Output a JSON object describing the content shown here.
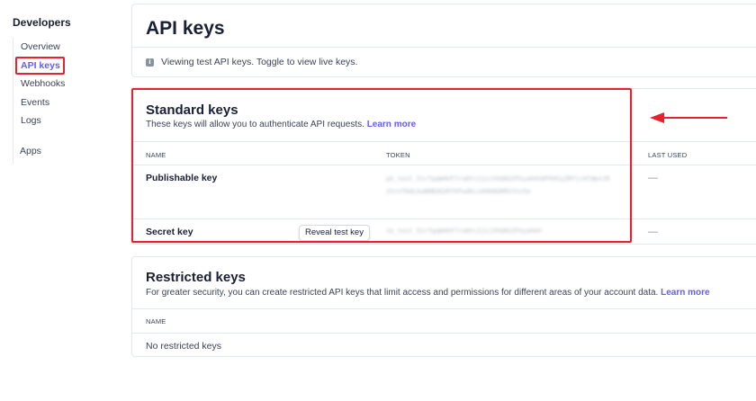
{
  "sidebar": {
    "title": "Developers",
    "items": [
      {
        "label": "Overview"
      },
      {
        "label": "API keys"
      },
      {
        "label": "Webhooks"
      },
      {
        "label": "Events"
      },
      {
        "label": "Logs"
      },
      {
        "label": "Apps"
      }
    ],
    "active_index": 1
  },
  "header": {
    "title": "API keys",
    "info_text": "Viewing test API keys. Toggle to view live keys."
  },
  "standard": {
    "title": "Standard keys",
    "description": "These keys will allow you to authenticate API requests.",
    "learn_more": "Learn more",
    "columns": {
      "name": "NAME",
      "token": "TOKEN",
      "last_used": "LAST USED"
    },
    "rows": [
      {
        "name": "Publishable key",
        "token": "pk_test_51rTgqW4hF7ra8Yc2jLCXhQ8UZFkyaH4X8FR4SyZM7jcHlWpnJR2ScnT6dLbuW8B3Q2RfHTwdkcz89bNd6M1Ynz5a",
        "last_used": "—"
      },
      {
        "name": "Secret key",
        "token": "sk_test_51rTgqW4hF7ra8Yc2jLCXhQ8UZFkyaH4X",
        "last_used": "—",
        "reveal_label": "Reveal test key"
      }
    ]
  },
  "restricted": {
    "title": "Restricted keys",
    "description": "For greater security, you can create restricted API keys that limit access and permissions for different areas of your account data.",
    "learn_more": "Learn more",
    "column_name": "NAME",
    "empty_text": "No restricted keys"
  },
  "colors": {
    "accent": "#635bff",
    "annotation": "#e5222f"
  }
}
